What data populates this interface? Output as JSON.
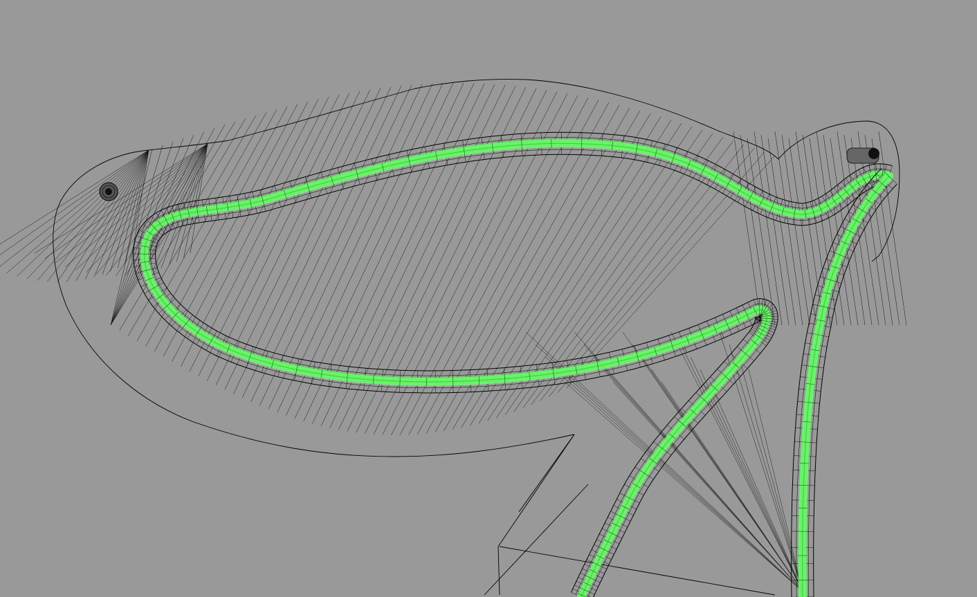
{
  "viewport": {
    "mode": "wireframe",
    "background": "#999999",
    "wire_color": "#000000",
    "highlight_color": "#66f866",
    "highlight_core_color": "#3fd23f"
  },
  "icons": {
    "pivot_marker_left": "pivot-marker-icon",
    "pivot_marker_right": "pivot-marker-icon"
  }
}
